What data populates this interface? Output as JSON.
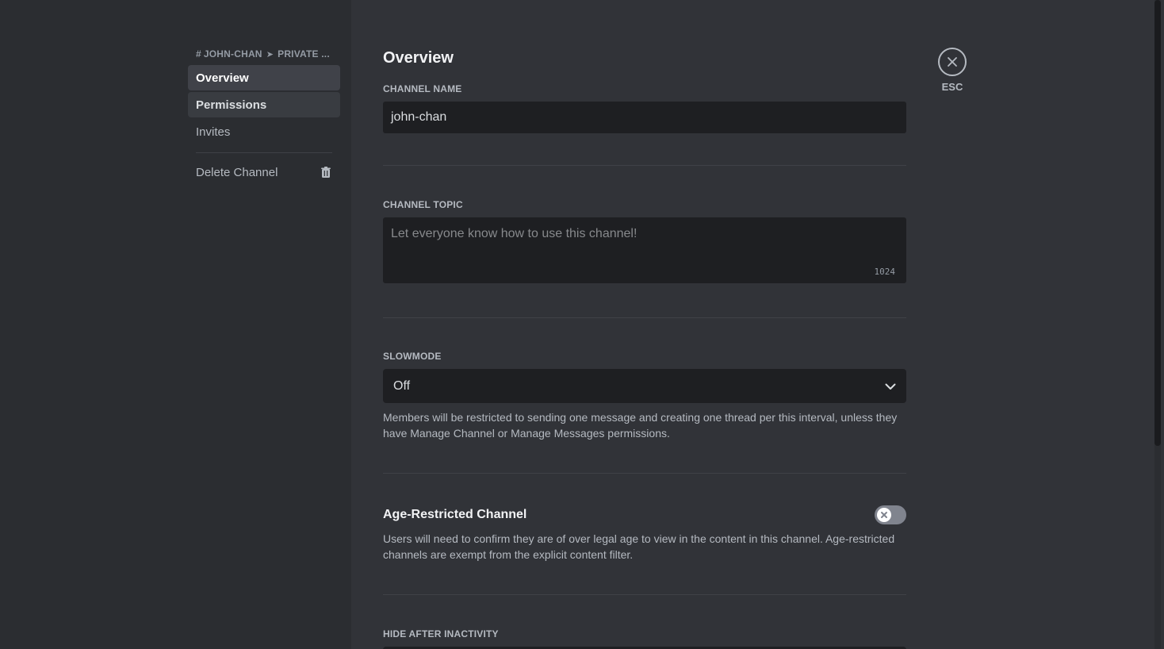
{
  "sidebar": {
    "breadcrumb": {
      "channel": "JOHN-CHAN",
      "category": "PRIVATE ..."
    },
    "items": [
      {
        "label": "Overview"
      },
      {
        "label": "Permissions"
      },
      {
        "label": "Invites"
      }
    ],
    "delete_label": "Delete Channel"
  },
  "main": {
    "title": "Overview",
    "channel_name": {
      "label": "CHANNEL NAME",
      "value": "john-chan"
    },
    "channel_topic": {
      "label": "CHANNEL TOPIC",
      "placeholder": "Let everyone know how to use this channel!",
      "char_count": "1024"
    },
    "slowmode": {
      "label": "SLOWMODE",
      "value": "Off",
      "help": "Members will be restricted to sending one message and creating one thread per this interval, unless they have Manage Channel or Manage Messages permissions."
    },
    "age_restricted": {
      "title": "Age-Restricted Channel",
      "enabled": false,
      "help": "Users will need to confirm they are of over legal age to view in the content in this channel. Age-restricted channels are exempt from the explicit content filter."
    },
    "hide_after_inactivity": {
      "label": "HIDE AFTER INACTIVITY"
    }
  },
  "close": {
    "esc_label": "ESC"
  },
  "colors": {
    "background": "#313338",
    "sidebar": "#2b2d31",
    "input": "#1e1f22",
    "selected_item": "#404249"
  }
}
